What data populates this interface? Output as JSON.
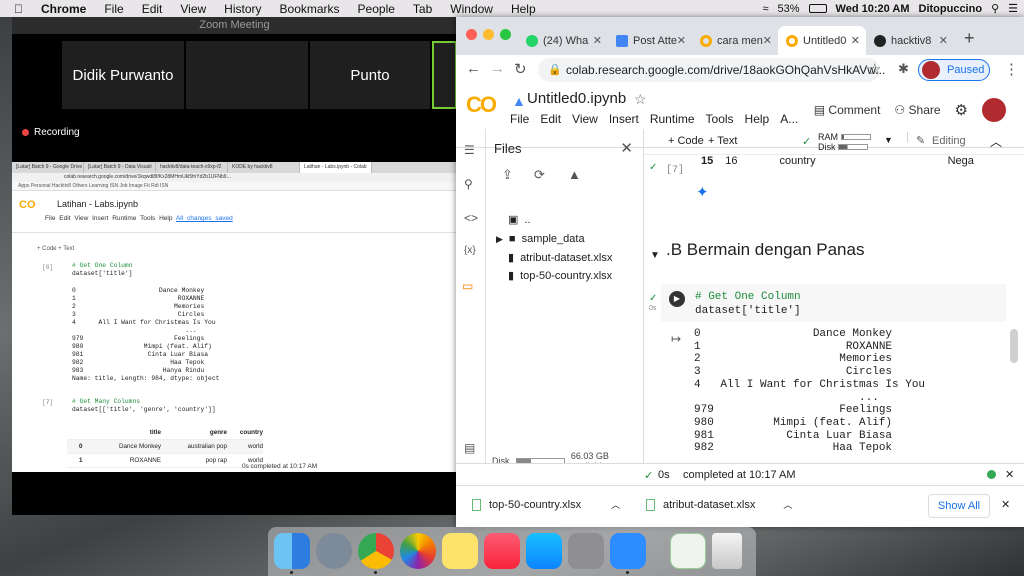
{
  "menubar": {
    "apple": "",
    "items": [
      "Chrome",
      "File",
      "Edit",
      "View",
      "History",
      "Bookmarks",
      "People",
      "Tab",
      "Window",
      "Help"
    ],
    "battery": "53%",
    "datetime": "Wed 10:20 AM",
    "user": "Ditopuccino"
  },
  "zoom": {
    "title": "Zoom Meeting",
    "participants": [
      "Didik Purwanto",
      "",
      "Punto"
    ],
    "recording": "Recording"
  },
  "shared": {
    "tabs": [
      "[Latar] Batch 9 - Google Drive",
      "[Latar] Batch 9 - Data Visuali",
      "hacktiv8/data-teach-s9xp-f2",
      "KODE by hacktiv8",
      "Latihan - Labs.ipynb - Colab"
    ],
    "url": "colab.research.google.com/drive/1kqwdl8f/Kx28MHmUkl5fnYd2b1UFNb9...",
    "bookmarks": "Apps  Personal  Hacktiv8  Others  Learning  ISN  Job  Image  Fit  Rdi  ISN",
    "logo": "CO",
    "title": "Latihan - Labs.ipynb",
    "menu": [
      "File",
      "Edit",
      "View",
      "Insert",
      "Runtime",
      "Tools",
      "Help"
    ],
    "saved": "All changes saved",
    "code_text": "+ Code   + Text",
    "cell1_num": "[6]",
    "cell1_comment": "# Get One Column",
    "cell1_code": "dataset['title']",
    "out1": "0                      Dance Monkey\n1                           ROXANNE\n2                          Memories\n3                           Circles\n4      All I Want for Christmas Is You\n                              ...\n979                        Feelings\n980                Mimpi (feat. Alif)\n981                 Cinta Luar Biasa\n982                       Haa Tepok\n983                     Hanya Rindu\nName: title, Length: 984, dtype: object",
    "cell2_num": "[7]",
    "cell2_comment": "# Get Many Columns",
    "cell2_code": "dataset[['title', 'genre', 'country']]",
    "table_headers": [
      "",
      "title",
      "genre",
      "country"
    ],
    "table_rows": [
      [
        "0",
        "Dance Monkey",
        "australian pop",
        "world"
      ],
      [
        "1",
        "ROXANNE",
        "pop rap",
        "world"
      ]
    ],
    "status": "0s     completed at 10:17 AM"
  },
  "chrome": {
    "tabs": [
      {
        "label": "(24) Wha",
        "color": "#25d366",
        "badge": "24"
      },
      {
        "label": "Post Atte",
        "color": "#4285f4"
      },
      {
        "label": "cara men",
        "color": "#f9ab00"
      },
      {
        "label": "Untitled0",
        "color": "#f9ab00"
      },
      {
        "label": "hacktiv8",
        "color": "#222222"
      }
    ],
    "new_tab": "+",
    "url": "colab.research.google.com/drive/18aokGOhQahVsHkAVw...",
    "paused": "Paused"
  },
  "colab": {
    "logo": "CO",
    "title": "Untitled0.ipynb",
    "menu": [
      "File",
      "Edit",
      "View",
      "Insert",
      "Runtime",
      "Tools",
      "Help",
      "A..."
    ],
    "comment": "Comment",
    "share": "Share",
    "add_code": "+ Code",
    "add_text": "+ Text",
    "ram": "RAM",
    "disk": "Disk",
    "editing": "Editing"
  },
  "files": {
    "header": "Files",
    "items": [
      "..",
      "sample_data",
      "atribut-dataset.xlsx",
      "top-50-country.xlsx"
    ],
    "disk_label": "Disk",
    "disk_available": "66.03 GB available"
  },
  "notebook": {
    "prev_cell_num": "[7]",
    "prev_row": [
      "15",
      "16",
      "country",
      "Nega"
    ],
    "section": ".B Bermain dengan Panas",
    "exec_time": "0s",
    "cell_comment": "# Get One Column",
    "cell_code": "dataset['title']",
    "output": "0                 Dance Monkey\n1                      ROXANNE\n2                     Memories\n3                      Circles\n4   All I Want for Christmas Is You\n                         ...\n979                   Feelings\n980         Mimpi (feat. Alif)\n981           Cinta Luar Biasa\n982                  Haa Tepok"
  },
  "status": {
    "time": "0s",
    "completed": "completed at 10:17 AM"
  },
  "downloads": {
    "items": [
      "top-50-country.xlsx",
      "atribut-dataset.xlsx"
    ],
    "show_all": "Show All"
  },
  "dock": {
    "apps": [
      "finder-icon",
      "launchpad-icon",
      "chrome-icon",
      "photos-icon",
      "notes-icon",
      "music-icon",
      "app-store-icon",
      "system-preferences-icon",
      "zoom-icon",
      "spreadsheet-file-icon",
      "trash-icon"
    ]
  }
}
